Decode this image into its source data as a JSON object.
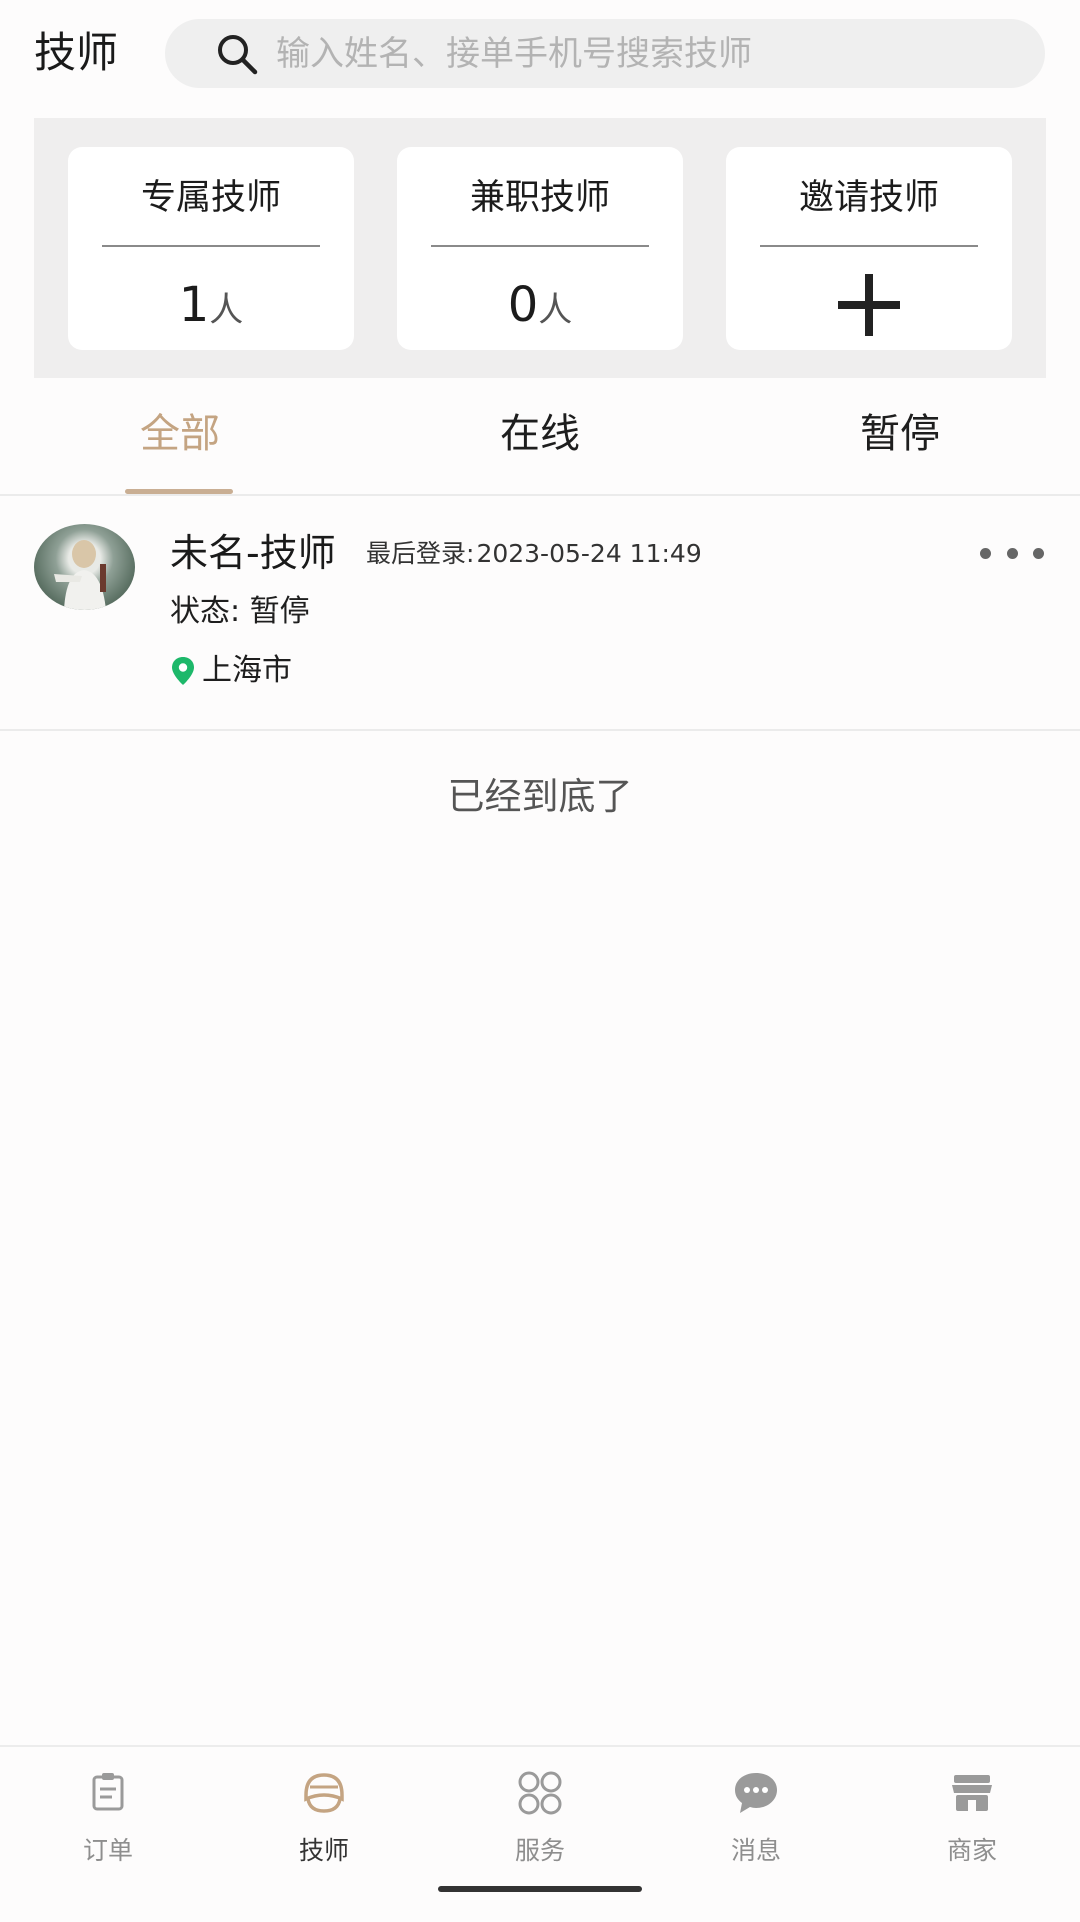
{
  "header": {
    "title": "技师",
    "search_placeholder": "输入姓名、接单手机号搜索技师"
  },
  "stats": {
    "exclusive": {
      "title": "专属技师",
      "count": "1",
      "unit": "人"
    },
    "part_time": {
      "title": "兼职技师",
      "count": "0",
      "unit": "人"
    },
    "invite": {
      "title": "邀请技师"
    }
  },
  "tabs": [
    {
      "label": "全部",
      "active": true
    },
    {
      "label": "在线",
      "active": false
    },
    {
      "label": "暂停",
      "active": false
    }
  ],
  "technicians": [
    {
      "name": "未名-技师",
      "last_login_label": "最后登录:",
      "last_login": "2023-05-24 11:49",
      "status": "状态: 暂停",
      "city": "上海市"
    }
  ],
  "list_end_text": "已经到底了",
  "bottom_nav": [
    {
      "label": "订单",
      "icon": "order-icon",
      "active": false
    },
    {
      "label": "技师",
      "icon": "technician-icon",
      "active": true
    },
    {
      "label": "服务",
      "icon": "service-icon",
      "active": false
    },
    {
      "label": "消息",
      "icon": "message-icon",
      "active": false
    },
    {
      "label": "商家",
      "icon": "store-icon",
      "active": false
    }
  ],
  "colors": {
    "accent": "#c4a482",
    "panel_bg": "#efeeee",
    "location_pin": "#1db86a"
  }
}
